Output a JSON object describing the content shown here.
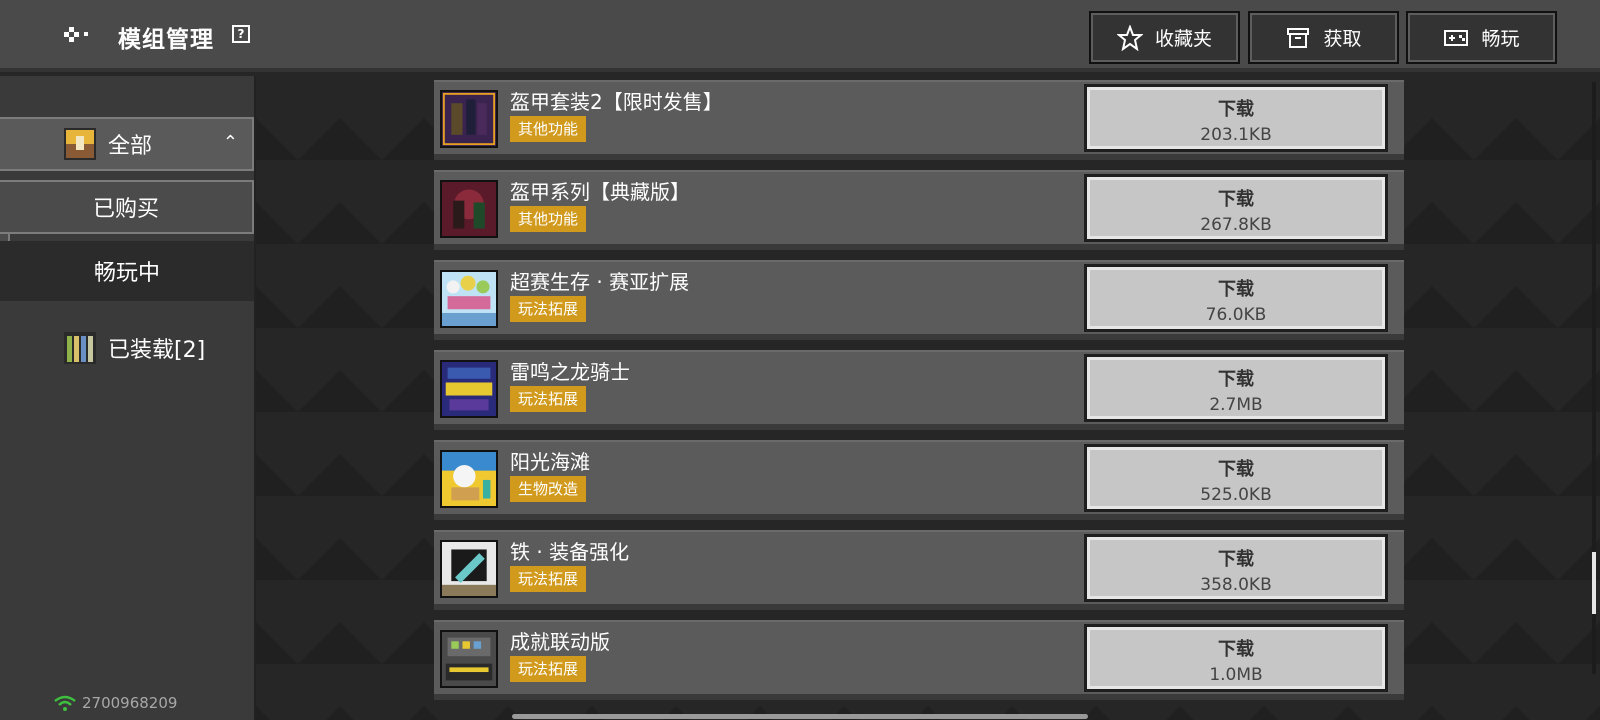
{
  "header": {
    "title": "模组管理",
    "help": "?",
    "buttons": {
      "favorites": "收藏夹",
      "get": "获取",
      "play": "畅玩"
    }
  },
  "sidebar": {
    "all": "全部",
    "bought": "已购买",
    "playing": "畅玩中",
    "loaded": "已装载[2]",
    "account_id": "2700968209"
  },
  "mods": [
    {
      "title": "盔甲套装2【限时发售】",
      "tag": "其他功能",
      "action": "下载",
      "size": "203.1KB"
    },
    {
      "title": "盔甲系列【典藏版】",
      "tag": "其他功能",
      "action": "下载",
      "size": "267.8KB"
    },
    {
      "title": "超赛生存 · 赛亚扩展",
      "tag": "玩法拓展",
      "action": "下载",
      "size": "76.0KB"
    },
    {
      "title": "雷鸣之龙骑士",
      "tag": "玩法拓展",
      "action": "下载",
      "size": "2.7MB"
    },
    {
      "title": "阳光海滩",
      "tag": "生物改造",
      "action": "下载",
      "size": "525.0KB"
    },
    {
      "title": "铁 · 装备强化",
      "tag": "玩法拓展",
      "action": "下载",
      "size": "358.0KB"
    },
    {
      "title": "成就联动版",
      "tag": "玩法拓展",
      "action": "下载",
      "size": "1.0MB"
    }
  ],
  "colors": {
    "header_bg": "#4a4a4a",
    "tag_bg": "#d29a1c",
    "row_bg": "#5b5b5b",
    "download_bg": "#c6c6c6"
  }
}
